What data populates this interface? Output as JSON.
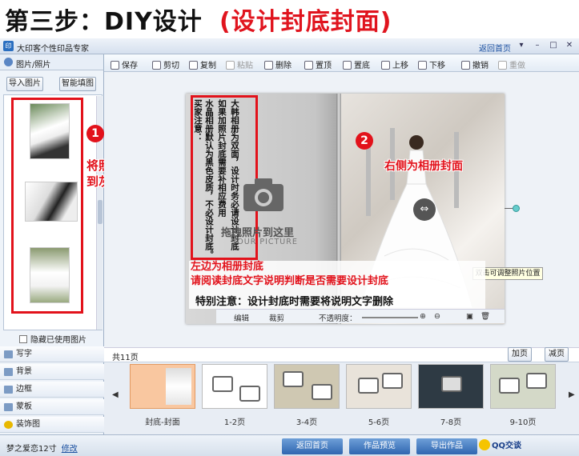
{
  "banner": {
    "step": "第三步：DIY设计",
    "highlight": "(设计封底封面)"
  },
  "window": {
    "app_name": "大印客个性印品专家",
    "home_link": "返回首页",
    "logo": "印"
  },
  "left_panel": {
    "header": "图片/照片",
    "import_button": "导入图片",
    "smart_fill_button": "智能填图",
    "hide_used_label": "隐藏已使用图片",
    "tabs": [
      {
        "label": "写字",
        "icon": "text-icon"
      },
      {
        "label": "背景",
        "icon": "background-icon"
      },
      {
        "label": "边框",
        "icon": "frame-icon"
      },
      {
        "label": "蒙板",
        "icon": "mask-icon"
      },
      {
        "label": "装饰图",
        "icon": "star-icon"
      }
    ]
  },
  "toolbar": {
    "items": [
      {
        "label": "保存",
        "enabled": true
      },
      {
        "label": "剪切",
        "enabled": true
      },
      {
        "label": "复制",
        "enabled": true
      },
      {
        "label": "粘贴",
        "enabled": false
      },
      {
        "label": "删除",
        "enabled": true
      },
      {
        "label": "置顶",
        "enabled": true
      },
      {
        "label": "置底",
        "enabled": true
      },
      {
        "label": "上移",
        "enabled": true
      },
      {
        "label": "下移",
        "enabled": true
      },
      {
        "label": "撤销",
        "enabled": true
      },
      {
        "label": "重做",
        "enabled": false
      }
    ]
  },
  "annotations": {
    "step1_number": "1",
    "step1_text_line1": "将照片拖拽",
    "step1_text_line2": "到灰色区域",
    "step2_number": "2",
    "step2_text": "右侧为相册封面",
    "left_note_line1": "左边为相册封底",
    "left_note_line2": "请阅读封底文字说明判断是否需要设计封底",
    "special_note": "特别注意：设计封底时需要将说明文字删除"
  },
  "back_cover_notice": {
    "columns": [
      "大韩相册为双面，设计时务必请设计封底",
      "如果加照片封底需要补相应费用",
      "水晶相册默认为黑色皮质，不必设计封底。",
      "买家注意："
    ]
  },
  "canvas": {
    "drop_hint": "拖拽照片到这里",
    "drop_hint_en": "YOUR PICTURE",
    "tooltip": "双击可调整照片位置",
    "image_bar": {
      "edit": "编辑",
      "crop": "裁剪",
      "opacity_label": "不透明度："
    }
  },
  "pages": {
    "count_label": "共11页",
    "add_button": "加页",
    "remove_button": "减页",
    "items": [
      "封底-封面",
      "1-2页",
      "3-4页",
      "5-6页",
      "7-8页",
      "9-10页"
    ]
  },
  "status": {
    "user": "梦之爱恋12寸",
    "modify_link": "修改",
    "back_home": "返回首页",
    "preview": "作品预览",
    "export": "导出作品",
    "qq": "QQ交谈"
  }
}
